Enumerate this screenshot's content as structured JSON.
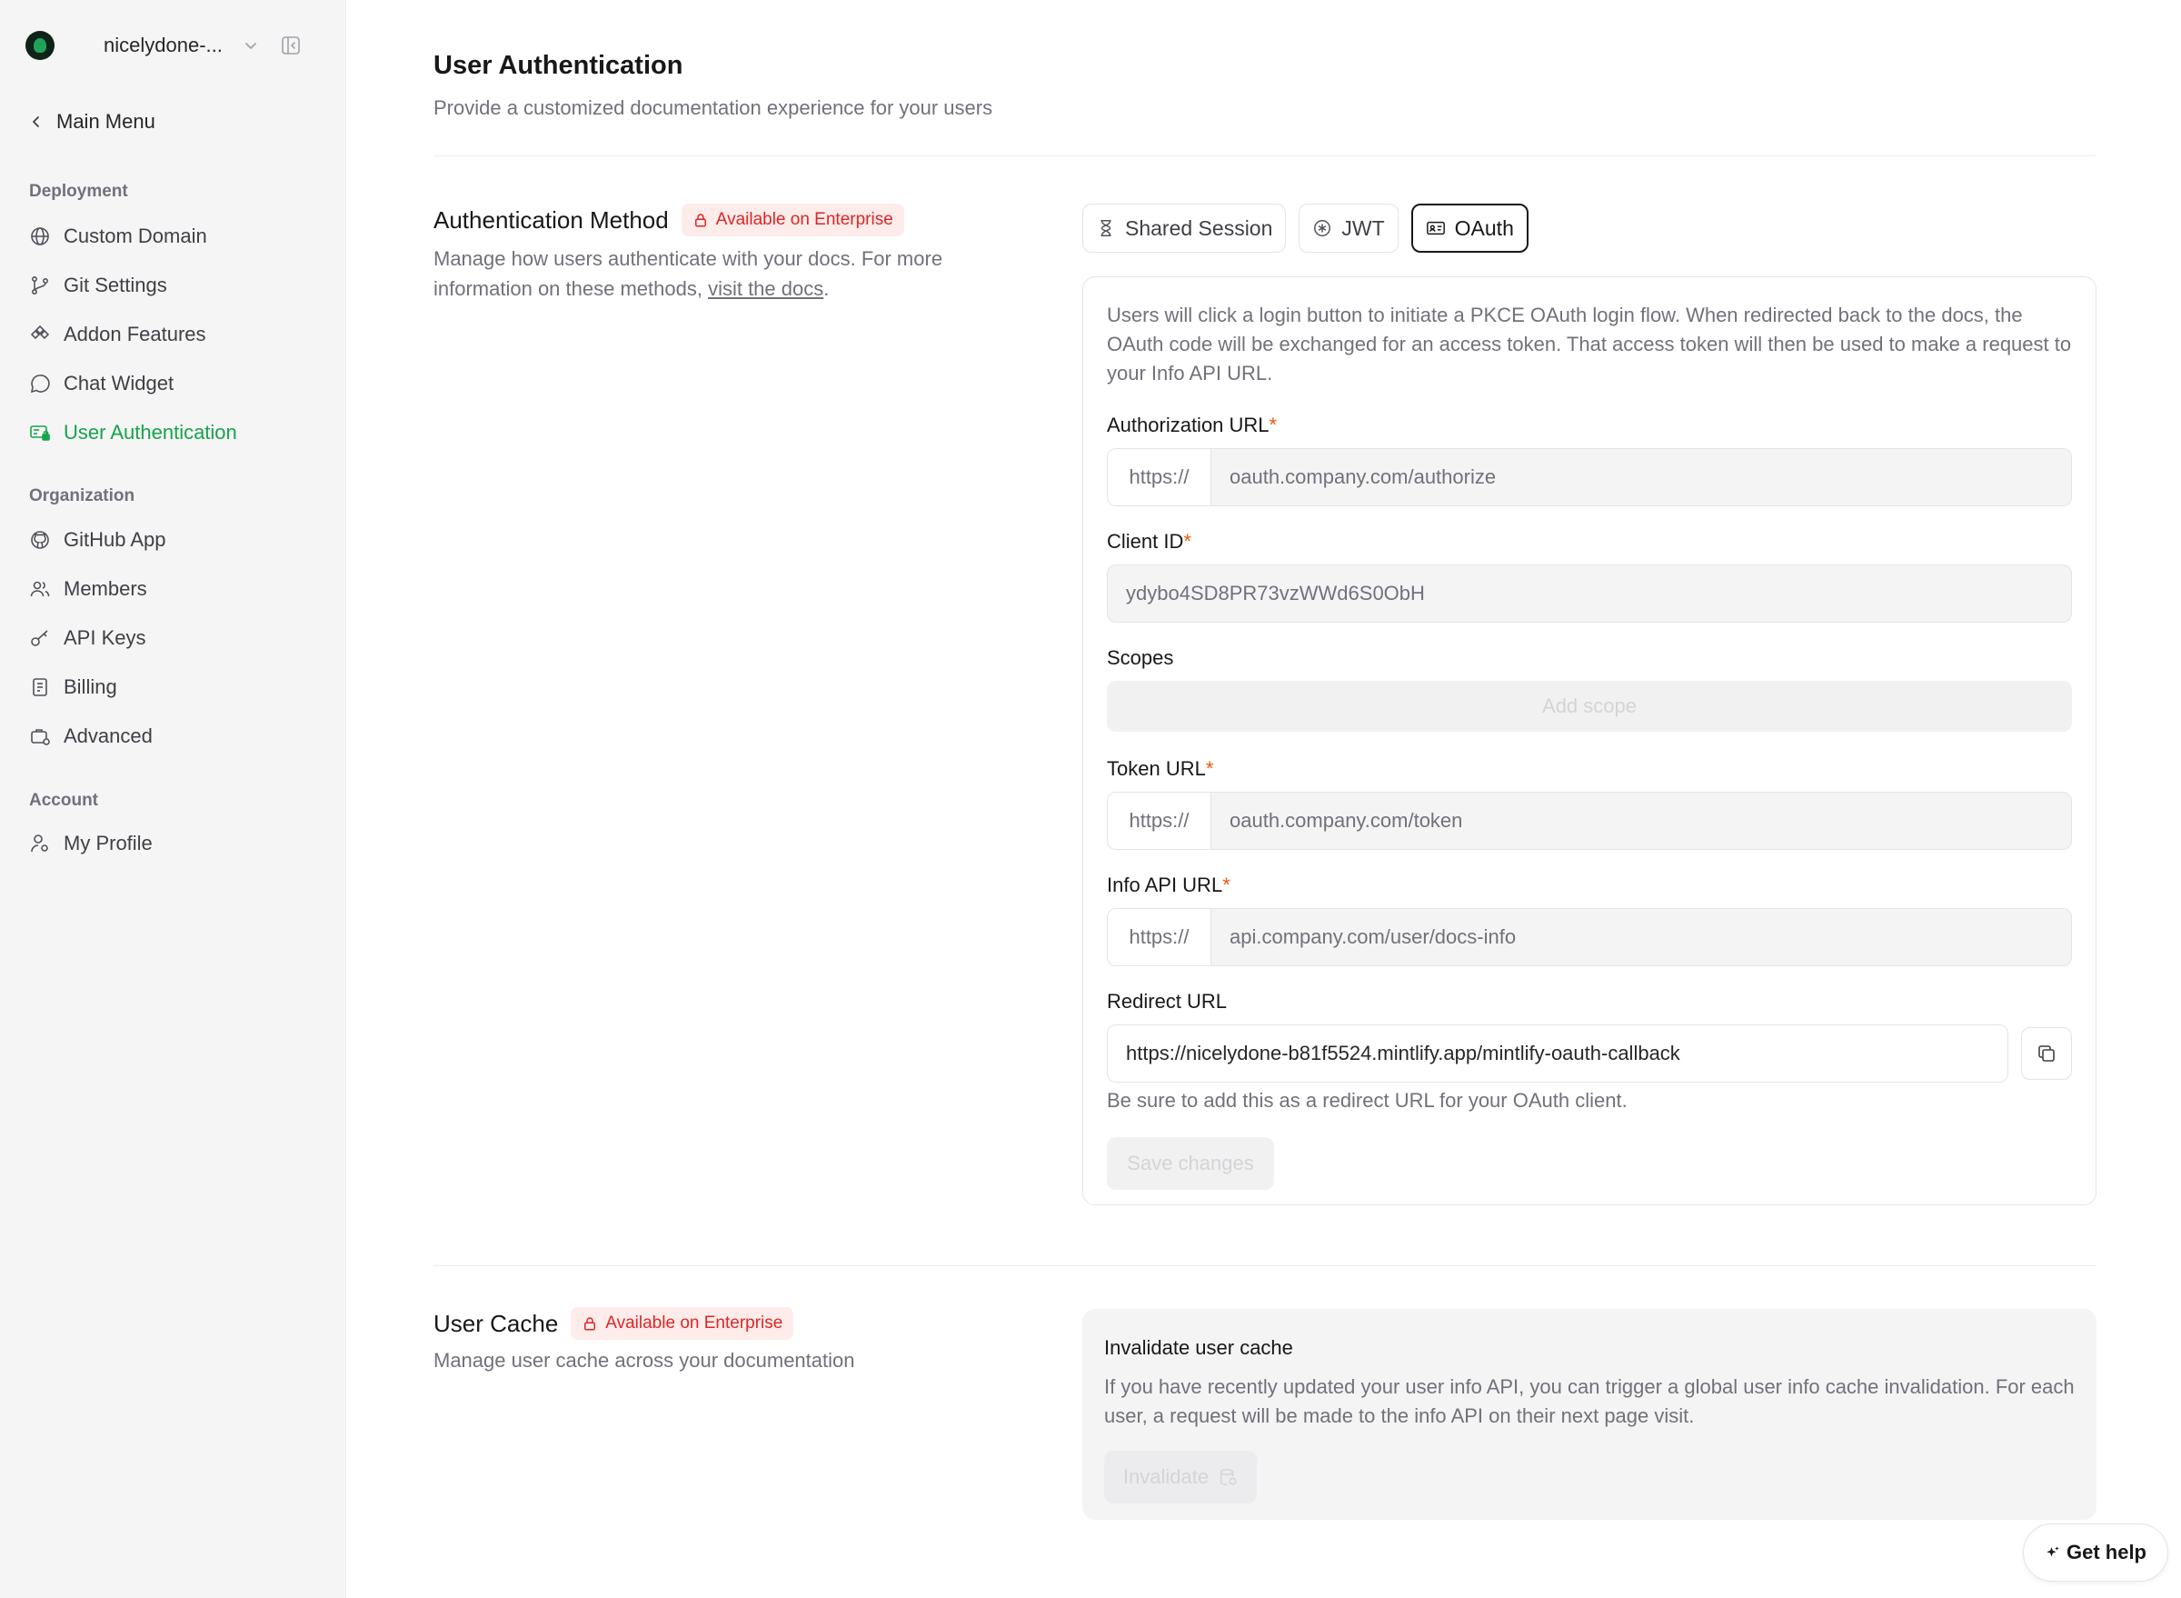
{
  "sidebar": {
    "org_name": "nicelydone-...",
    "main_menu": "Main Menu",
    "sections": {
      "deployment": "Deployment",
      "organization": "Organization",
      "account": "Account"
    },
    "items": {
      "custom_domain": "Custom Domain",
      "git_settings": "Git Settings",
      "addon_features": "Addon Features",
      "chat_widget": "Chat Widget",
      "user_authentication": "User Authentication",
      "github_app": "GitHub App",
      "members": "Members",
      "api_keys": "API Keys",
      "billing": "Billing",
      "advanced": "Advanced",
      "my_profile": "My Profile"
    },
    "active_item": "User Authentication",
    "active_color": "#16a34a"
  },
  "page": {
    "title": "User Authentication",
    "subtitle": "Provide a customized documentation experience for your users"
  },
  "auth_method": {
    "title": "Authentication Method",
    "badge": "Available on Enterprise",
    "desc_prefix": "Manage how users authenticate with your docs. For more information on these methods, ",
    "desc_link": "visit the docs",
    "desc_suffix": ".",
    "tabs": {
      "shared_session": "Shared Session",
      "jwt": "JWT",
      "oauth": "OAuth"
    },
    "active_tab": "OAuth"
  },
  "oauth": {
    "intro": "Users will click a login button to initiate a PKCE OAuth login flow. When redirected back to the docs, the OAuth code will be exchanged for an access token. That access token will then be used to make a request to your Info API URL.",
    "required_mark": "*",
    "authorization_url": {
      "label": "Authorization URL",
      "prefix": "https://",
      "placeholder": "oauth.company.com/authorize"
    },
    "client_id": {
      "label": "Client ID",
      "value": "ydybo4SD8PR73vzWWd6S0ObH"
    },
    "scopes": {
      "label": "Scopes",
      "button": "Add scope"
    },
    "token_url": {
      "label": "Token URL",
      "prefix": "https://",
      "placeholder": "oauth.company.com/token"
    },
    "info_api_url": {
      "label": "Info API URL",
      "prefix": "https://",
      "placeholder": "api.company.com/user/docs-info"
    },
    "redirect_url": {
      "label": "Redirect URL",
      "value": "https://nicelydone-b81f5524.mintlify.app/mintlify-oauth-callback",
      "helper": "Be sure to add this as a redirect URL for your OAuth client."
    },
    "save_button": "Save changes"
  },
  "user_cache": {
    "title": "User Cache",
    "badge": "Available on Enterprise",
    "desc": "Manage user cache across your documentation",
    "card_title": "Invalidate user cache",
    "card_desc": "If you have recently updated your user info API, you can trigger a global user info cache invalidation. For each user, a request will be made to the info API on their next page visit.",
    "button": "Invalidate"
  },
  "help_button": "Get help",
  "colors": {
    "accent_green": "#16a34a",
    "badge_red": "#dc2626",
    "required_orange": "#ea580c"
  }
}
